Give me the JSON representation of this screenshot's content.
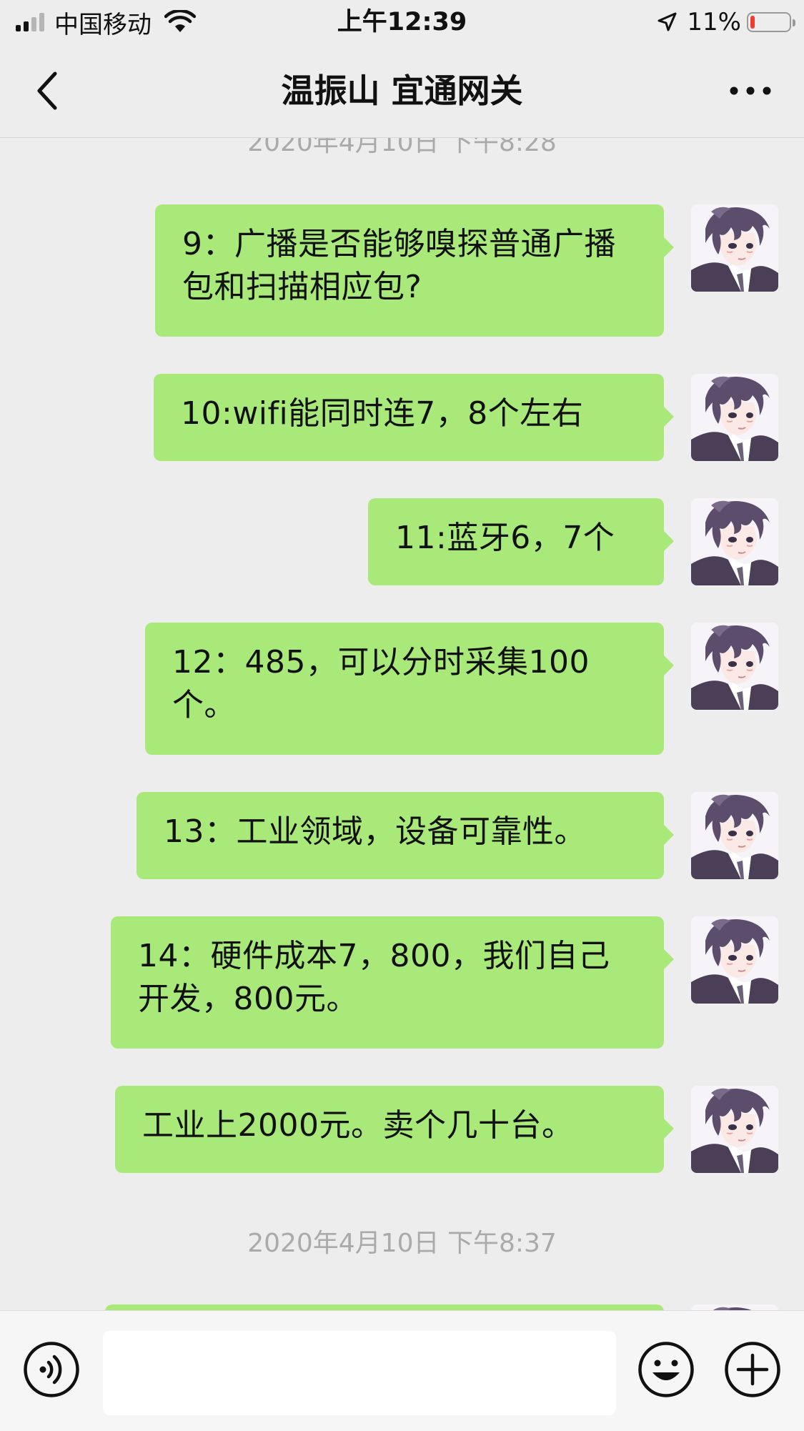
{
  "status_bar": {
    "carrier": "中国移动",
    "time": "上午12:39",
    "battery_percent": "11%",
    "battery_level": 0.11,
    "signal_bars_active": 2,
    "signal_bars_total": 4,
    "icons": [
      "signal-icon",
      "wifi-icon",
      "location-arrow-icon",
      "battery-icon"
    ],
    "battery_color": "#f03b30"
  },
  "header": {
    "title": "温振山 宜通网关",
    "back_icon": "chevron-left-icon",
    "more_icon": "more-dots-icon"
  },
  "chat": {
    "bubble_color": "#a9e97a",
    "background_color": "#ededed",
    "timestamps": [
      "2020年4月10日 下午8:28",
      "2020年4月10日 下午8:37"
    ],
    "messages": [
      {
        "sender": "self",
        "text": "9：广播是否能够嗅探普通广播包和扫描相应包?"
      },
      {
        "sender": "self",
        "text": "10:wifi能同时连7，8个左右"
      },
      {
        "sender": "self",
        "text": "11:蓝牙6，7个"
      },
      {
        "sender": "self",
        "text": "12：485，可以分时采集100个。"
      },
      {
        "sender": "self",
        "text": "13：工业领域，设备可靠性。"
      },
      {
        "sender": "self",
        "text": "14：硬件成本7，800，我们自己开发，800元。"
      },
      {
        "sender": "self",
        "text": "工业上2000元。卖个几十台。"
      }
    ]
  },
  "input_bar": {
    "placeholder": "",
    "icons": [
      "voice-icon",
      "emoji-icon",
      "plus-icon"
    ]
  }
}
